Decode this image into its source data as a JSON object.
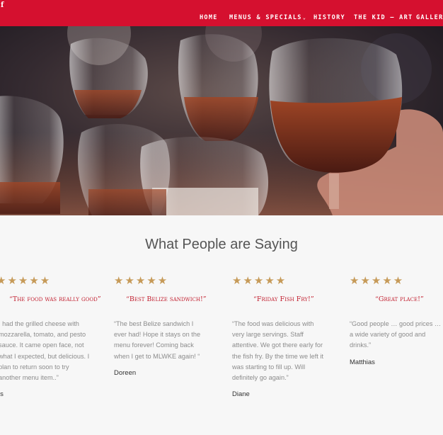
{
  "header": {
    "logo_fragment": "f",
    "nav": [
      {
        "label": "HOME"
      },
      {
        "label": "MENUS & SPECIALS",
        "dropdown": true
      },
      {
        "label": "HISTORY"
      },
      {
        "label": "THE KID – ART"
      },
      {
        "label": "GALLER"
      }
    ],
    "dropdown_glyph": "⌄",
    "bar_color": "#d5102f"
  },
  "hero": {
    "description_icon": "wine-glasses-toast-photo"
  },
  "testimonials": {
    "title": "What People are Saying",
    "star_glyphs": "★★★★★",
    "star_color": "#c69a58",
    "items": [
      {
        "rating": 5,
        "headline": "“The food was really good”",
        "body": "I had the grilled cheese with mozzarella, tomato, and pesto sauce. It came open face, not what I expected, but delicious. I plan to return soon to try another menu item..”",
        "author": "is"
      },
      {
        "rating": 5,
        "headline": "“Best Belize sandwich!”",
        "body": "“The best Belize sandwich I ever had! Hope it stays on the menu forever! Coming back when I get to MLWKE again! “",
        "author": "Doreen"
      },
      {
        "rating": 5,
        "headline": "“Friday Fish Fry!”",
        "body": "“The food was delicious with very large servings. Staff attentive. We got there early for the fish fry. By the time we left it was starting to fill up. Will definitely go again.”",
        "author": "Diane"
      },
      {
        "rating": 5,
        "headline": "“Great place!”",
        "body": "“Good people … good prices … a wide variety of good and drinks.”",
        "author": "Matthias"
      }
    ]
  }
}
